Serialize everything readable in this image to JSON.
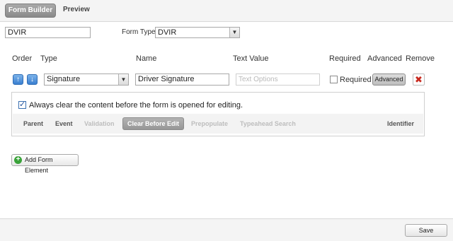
{
  "tabs": {
    "active": "Form Builder",
    "other": "Preview"
  },
  "form": {
    "name_value": "DVIR",
    "type_label": "Form Type:",
    "type_value": "DVIR"
  },
  "columns": {
    "order": "Order",
    "type": "Type",
    "name": "Name",
    "text_value": "Text Value",
    "required": "Required",
    "advanced": "Advanced",
    "remove": "Remove"
  },
  "element": {
    "type_value": "Signature",
    "name_value": "Driver Signature",
    "text_value_placeholder": "Text Options",
    "required_label": "Required",
    "required_checked": false,
    "advanced_button": "Advanced",
    "remove_icon": "x-icon"
  },
  "advanced_panel": {
    "option_text": "Always clear the content before the form is opened for editing.",
    "option_checked": true,
    "subtabs": {
      "parent": "Parent",
      "event": "Event",
      "validation": "Validation",
      "clear_before_edit": "Clear Before Edit",
      "prepopulate": "Prepopulate",
      "typeahead_search": "Typeahead Search",
      "identifier": "Identifier"
    }
  },
  "add_element_button": "Add Form Element",
  "save_button": "Save",
  "colors": {
    "accent_blue": "#3a7fd0",
    "remove_red": "#c8281e",
    "add_green": "#3aa33a"
  }
}
